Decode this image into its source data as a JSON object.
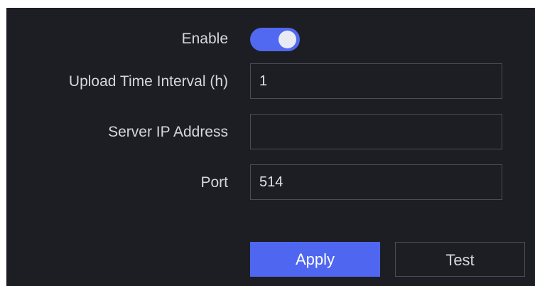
{
  "form": {
    "enable": {
      "label": "Enable",
      "state": "on"
    },
    "upload_interval": {
      "label": "Upload Time Interval (h)",
      "value": "1"
    },
    "server_ip": {
      "label": "Server IP Address",
      "value": ""
    },
    "port": {
      "label": "Port",
      "value": "514"
    }
  },
  "buttons": {
    "apply": "Apply",
    "test": "Test"
  },
  "colors": {
    "panel_bg": "#1d1e23",
    "accent": "#4f67f0",
    "text": "#d6d7db",
    "field_border": "#4b4d55"
  }
}
